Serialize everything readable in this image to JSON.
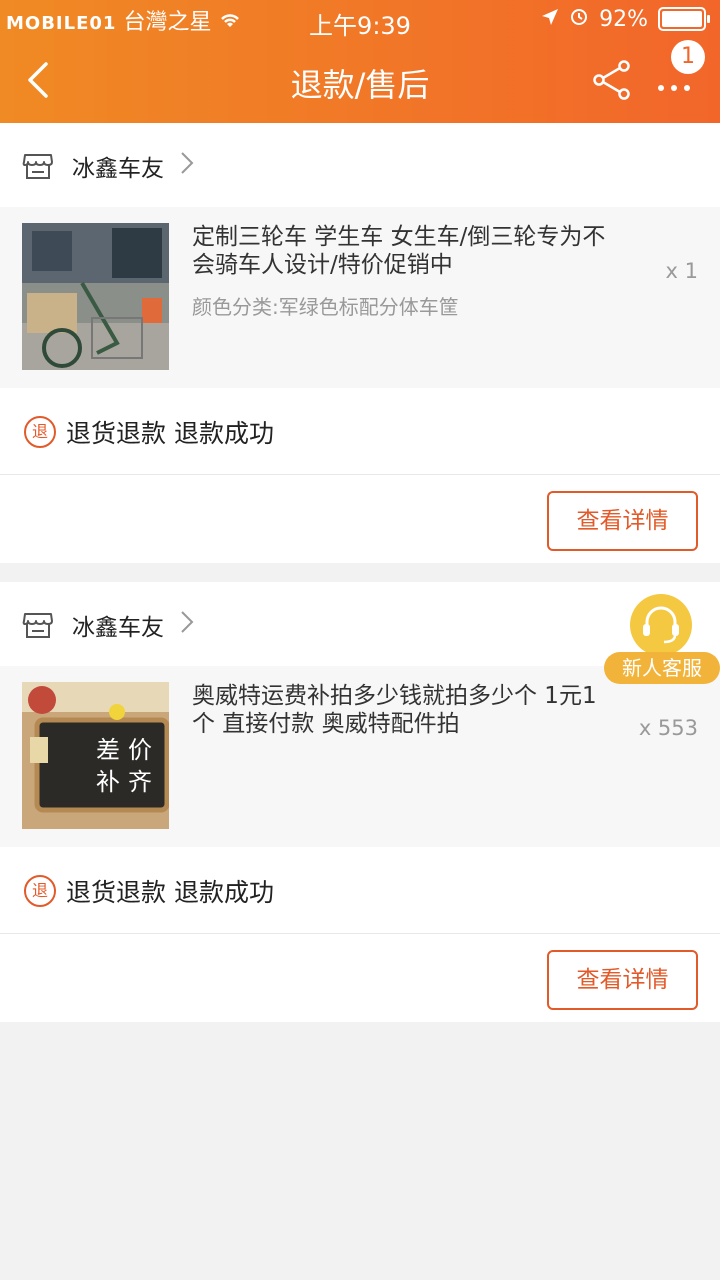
{
  "status_bar": {
    "watermark": "MOBILE01",
    "carrier": "台灣之星",
    "time": "上午9:39",
    "battery": "92%"
  },
  "nav": {
    "title": "退款/售后",
    "badge_count": "1",
    "icons": [
      "back-chevron-icon",
      "share-icon",
      "more-dots-icon"
    ]
  },
  "orders": [
    {
      "shop_name": "冰鑫车友",
      "item_title": "定制三轮车 学生车 女生车/倒三轮专为不会骑车人设计/特价促销中",
      "item_sku": "颜色分类:军绿色标配分体车筐",
      "quantity": "x 1",
      "refund_status": "退货退款 退款成功",
      "refund_icon_text": "退",
      "detail_button": "查看详情"
    },
    {
      "shop_name": "冰鑫车友",
      "item_title": "奥威特运费补拍多少钱就拍多少个 1元1个 直接付款 奥威特配件拍",
      "item_sku": "",
      "quantity": "x 553",
      "refund_status": "退货退款 退款成功",
      "refund_icon_text": "退",
      "detail_button": "查看详情",
      "thumb_text": [
        "差",
        "价",
        "补",
        "齐"
      ]
    }
  ],
  "customer_service": {
    "label": "新人客服"
  },
  "colors": {
    "header_gradient_start": "#f08a24",
    "header_gradient_end": "#f2662a",
    "accent": "#e35a2a"
  }
}
